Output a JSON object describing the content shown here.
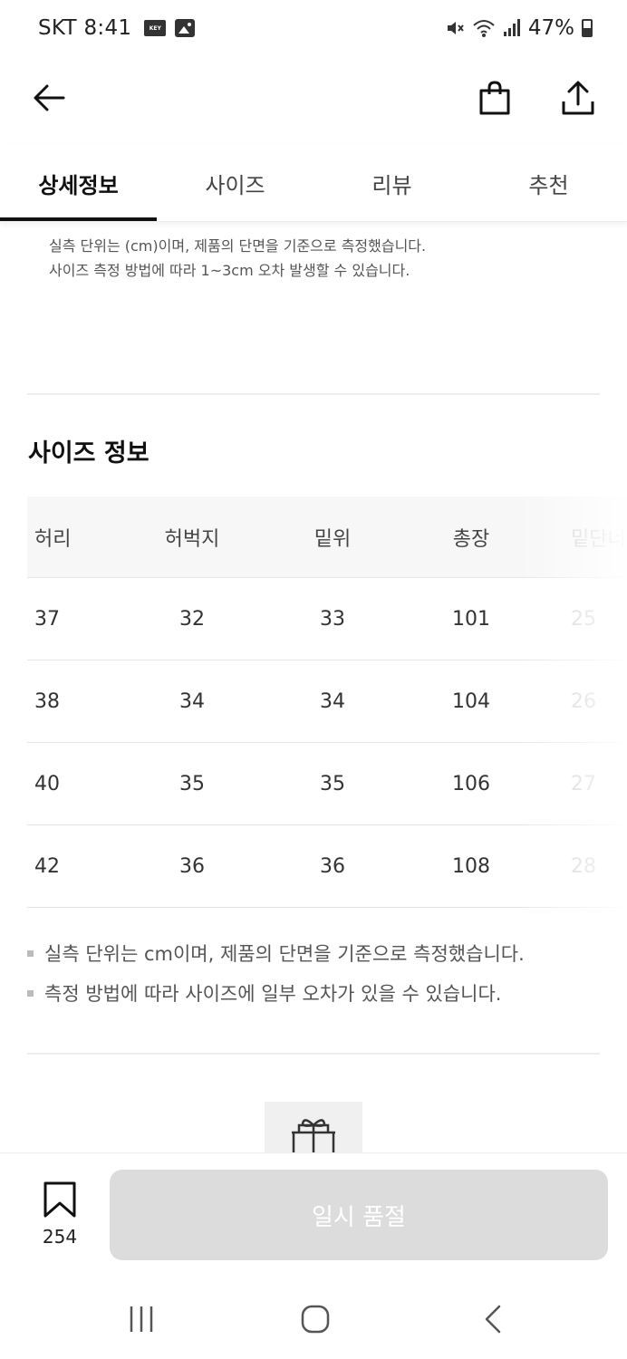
{
  "status_bar": {
    "carrier_time": "SKT 8:41",
    "key_badge": "KEY",
    "battery": "47%",
    "icons": [
      "key-icon",
      "gallery-icon",
      "mute-icon",
      "wifi-icon",
      "signal-icon",
      "battery-icon"
    ]
  },
  "nav": {
    "icons": [
      "back-arrow-icon",
      "shopping-bag-icon",
      "share-icon"
    ]
  },
  "tabs": [
    {
      "label": "상세정보",
      "active": true
    },
    {
      "label": "사이즈",
      "active": false
    },
    {
      "label": "리뷰",
      "active": false
    },
    {
      "label": "추천",
      "active": false
    }
  ],
  "top_note": {
    "line1": "실측 단위는 (cm)이며, 제품의 단면을 기준으로 측정했습니다.",
    "line2": "사이즈 측정 방법에 따라 1~3cm 오차 발생할 수 있습니다."
  },
  "size_section": {
    "title": "사이즈 정보",
    "headers": [
      "허리",
      "허벅지",
      "밑위",
      "총장",
      "밑단너"
    ],
    "rows": [
      [
        "37",
        "32",
        "33",
        "101",
        "25"
      ],
      [
        "38",
        "34",
        "34",
        "104",
        "26"
      ],
      [
        "40",
        "35",
        "35",
        "106",
        "27"
      ],
      [
        "42",
        "36",
        "36",
        "108",
        "28"
      ]
    ]
  },
  "bottom_notes": [
    "실측 단위는 cm이며, 제품의 단면을 기준으로 측정했습니다.",
    "측정 방법에 따라 사이즈에 일부 오차가 있을 수 있습니다."
  ],
  "action_bar": {
    "bookmark_count": "254",
    "soldout_label": "일시 품절",
    "soldout_color": "#dcdcdc"
  },
  "android_nav": {
    "icons": [
      "recent-apps-icon",
      "home-icon",
      "back-icon"
    ]
  }
}
